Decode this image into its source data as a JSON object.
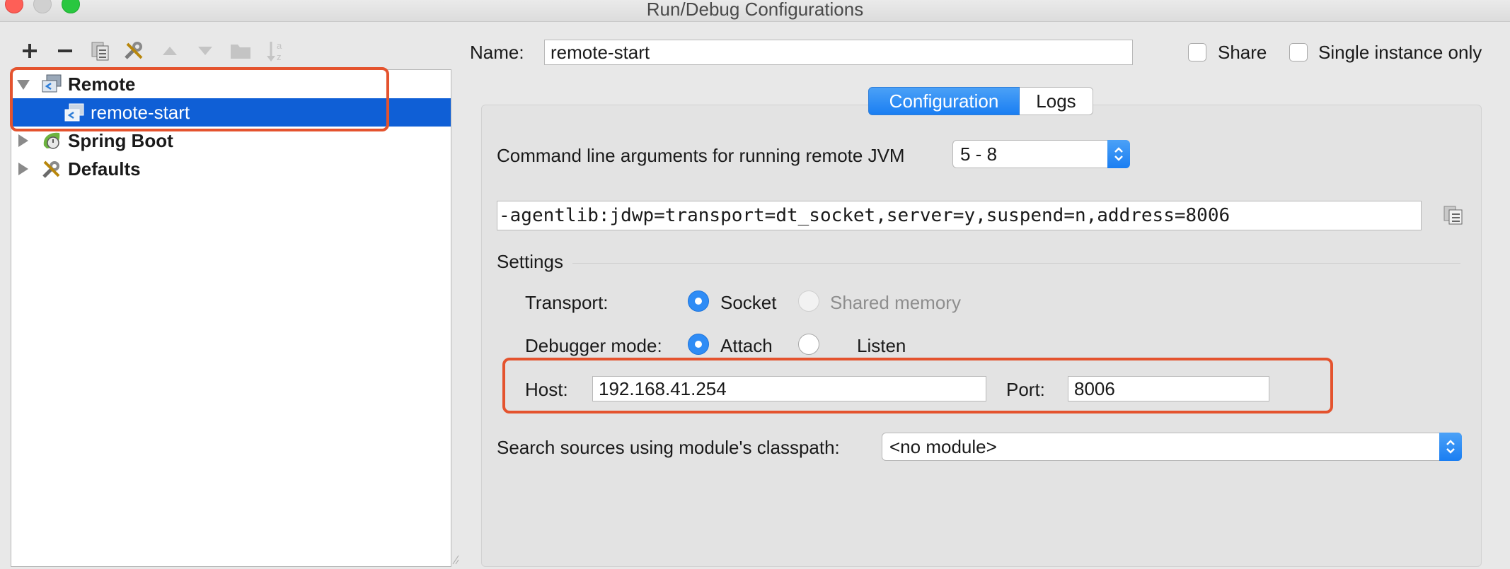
{
  "window": {
    "title": "Run/Debug Configurations"
  },
  "toolbar": {
    "icons": [
      "add-icon",
      "remove-icon",
      "copy-icon",
      "edit-defaults-icon",
      "move-up-icon",
      "move-down-icon",
      "folder-icon",
      "sort-icon"
    ]
  },
  "tree": {
    "items": [
      {
        "label": "Remote",
        "expanded": true
      },
      {
        "label": "remote-start",
        "selected": true
      },
      {
        "label": "Spring Boot",
        "expanded": false
      },
      {
        "label": "Defaults",
        "expanded": false
      }
    ]
  },
  "name_row": {
    "label": "Name:",
    "value": "remote-start",
    "share_label": "Share",
    "single_instance_label": "Single instance only"
  },
  "tabs": {
    "configuration": "Configuration",
    "logs": "Logs",
    "active": "Configuration"
  },
  "config": {
    "cmd_label": "Command line arguments for running remote JVM",
    "jvm_version": "5 - 8",
    "cmd_value": "-agentlib:jdwp=transport=dt_socket,server=y,suspend=n,address=8006",
    "settings_label": "Settings",
    "transport_label": "Transport:",
    "transport_socket": "Socket",
    "transport_shared": "Shared memory",
    "debugger_mode_label": "Debugger mode:",
    "mode_attach": "Attach",
    "mode_listen": "Listen",
    "host_label": "Host:",
    "host_value": "192.168.41.254",
    "port_label": "Port:",
    "port_value": "8006",
    "module_label": "Search sources using module's classpath:",
    "module_value": "<no module>"
  },
  "colors": {
    "accent": "#1a7ef2",
    "selection": "#0f5fd6",
    "highlight": "#e4532e"
  }
}
